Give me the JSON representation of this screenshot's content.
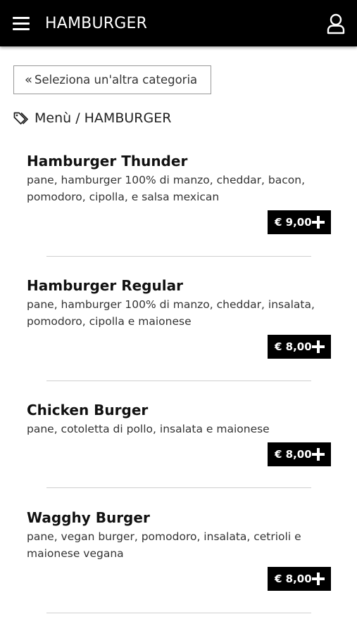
{
  "header": {
    "title": "HAMBURGER",
    "menu_icon": "hamburger-menu-icon",
    "user_icon": "user-icon",
    "background": "#000000"
  },
  "back_button": {
    "label": "Seleziona un'altra categoria",
    "icon": "double-chevron-left-icon"
  },
  "breadcrumb": {
    "icon": "tags-icon",
    "text": "Menù / HAMBURGER"
  },
  "items": [
    {
      "name": "Hamburger Thunder",
      "description": "pane, hamburger 100% di manzo, cheddar, bacon, pomodoro, cipolla, e salsa mexican",
      "price": "€ 9,00"
    },
    {
      "name": "Hamburger Regular",
      "description": "pane, hamburger 100% di manzo, cheddar, insalata, pomodoro, cipolla e maionese",
      "price": "€ 8,00"
    },
    {
      "name": "Chicken Burger",
      "description": "pane, cotoletta di pollo, insalata e maionese",
      "price": "€ 8,00"
    },
    {
      "name": "Wagghy Burger",
      "description": "pane, vegan burger, pomodoro, insalata, cetrioli e maionese vegana",
      "price": "€ 8,00"
    }
  ]
}
